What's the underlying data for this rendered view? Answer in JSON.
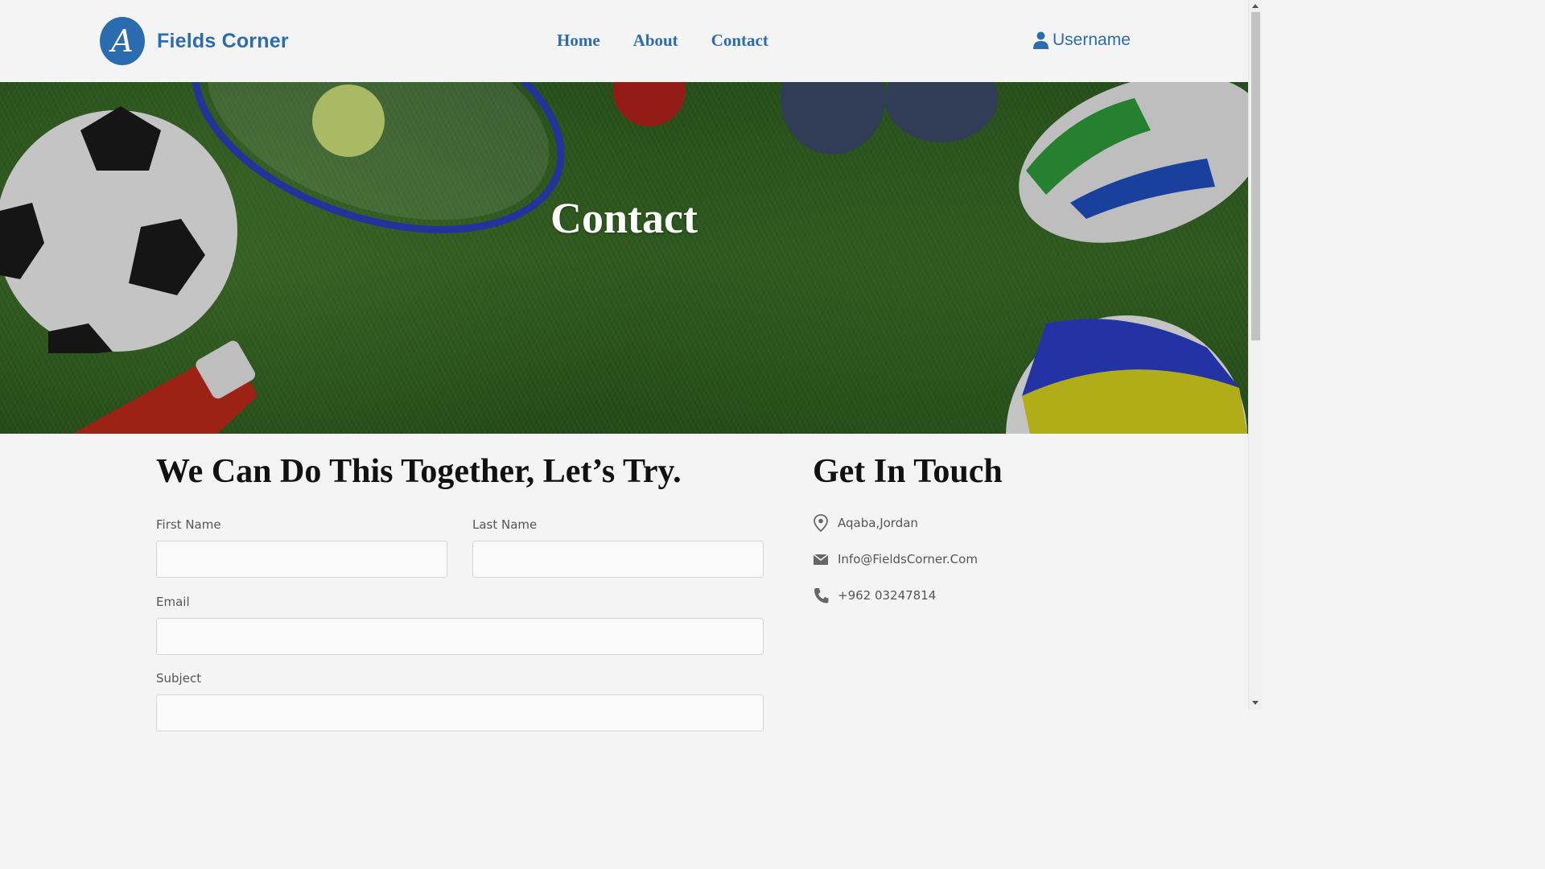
{
  "brand": {
    "logo_letter": "A",
    "name": "Fields Corner"
  },
  "nav": {
    "home": "Home",
    "about": "About",
    "contact": "Contact"
  },
  "user": {
    "label": "Username"
  },
  "hero": {
    "title": "Contact"
  },
  "form": {
    "heading": "We Can Do This Together, Let’s Try.",
    "first_name_label": "First Name",
    "first_name_value": "",
    "last_name_label": "Last Name",
    "last_name_value": "",
    "email_label": "Email",
    "email_value": "",
    "subject_label": "Subject",
    "subject_value": ""
  },
  "touch": {
    "heading": "Get In Touch",
    "address": "Aqaba,Jordan",
    "email": "Info@FieldsCorner.Com",
    "phone": "+962 03247814"
  },
  "colors": {
    "brand": "#2b6cb0",
    "page_bg": "#f4f4f4",
    "text": "#111111",
    "muted": "#555555"
  },
  "icons": {
    "user": "user-icon",
    "location": "map-pin-icon",
    "mail": "envelope-icon",
    "phone": "phone-icon"
  }
}
